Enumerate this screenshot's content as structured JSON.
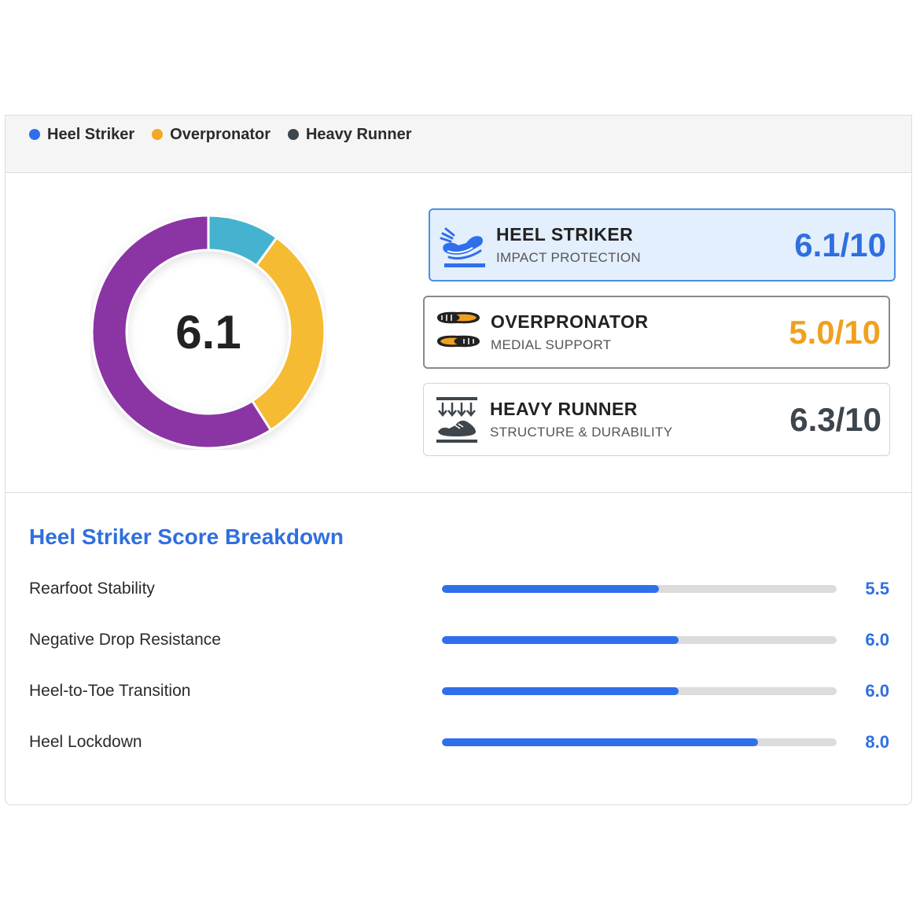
{
  "legend": [
    {
      "label": "Heel Striker",
      "color": "#2f6fec"
    },
    {
      "label": "Overpronator",
      "color": "#f5a623"
    },
    {
      "label": "Heavy Runner",
      "color": "#3d454d"
    }
  ],
  "donut": {
    "center_value": "6.1",
    "segments": [
      {
        "value": 10,
        "color": "#45b3cf"
      },
      {
        "value": 31,
        "color": "#f5bb33"
      },
      {
        "value": 59,
        "color": "#8a35a3"
      }
    ]
  },
  "cards": [
    {
      "title": "HEEL STRIKER",
      "subtitle": "IMPACT PROTECTION",
      "score": "6.1/10",
      "score_color": "#2f6fdf",
      "icon": "heel-striker-icon",
      "active": true
    },
    {
      "title": "OVERPRONATOR",
      "subtitle": "MEDIAL SUPPORT",
      "score": "5.0/10",
      "score_color": "#f0a020",
      "icon": "insole-icon",
      "active": false
    },
    {
      "title": "HEAVY RUNNER",
      "subtitle": "STRUCTURE & DURABILITY",
      "score": "6.3/10",
      "score_color": "#3d454d",
      "icon": "heavy-runner-icon",
      "active": false
    }
  ],
  "breakdown": {
    "title": "Heel Striker Score Breakdown",
    "max": 10,
    "rows": [
      {
        "label": "Rearfoot Stability",
        "value": 5.5,
        "display": "5.5"
      },
      {
        "label": "Negative Drop Resistance",
        "value": 6.0,
        "display": "6.0"
      },
      {
        "label": "Heel-to-Toe Transition",
        "value": 6.0,
        "display": "6.0"
      },
      {
        "label": "Heel Lockdown",
        "value": 8.0,
        "display": "8.0"
      }
    ]
  }
}
